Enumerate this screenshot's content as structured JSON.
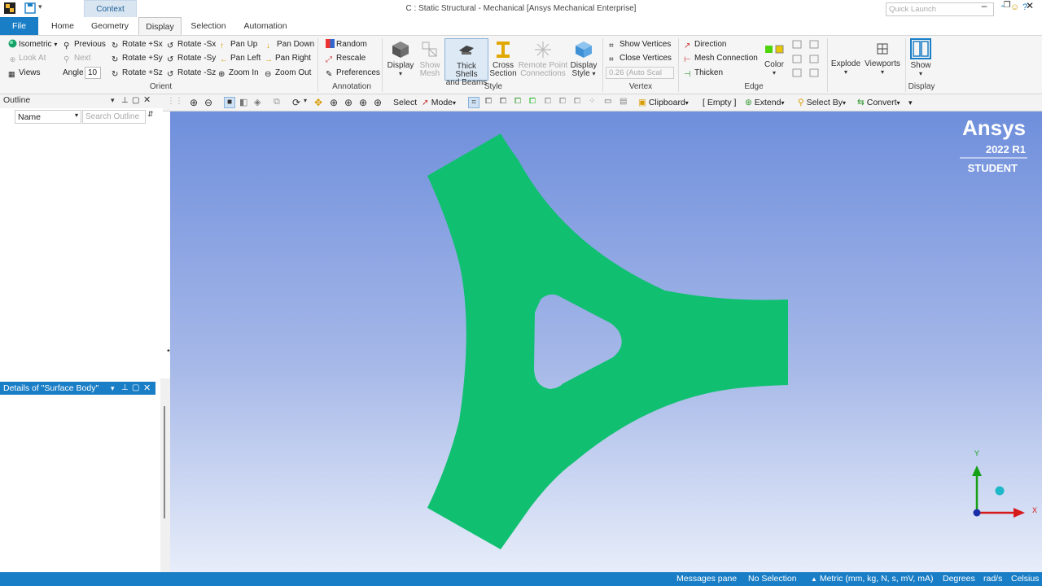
{
  "window": {
    "title": "C : Static Structural - Mechanical [Ansys Mechanical Enterprise]",
    "context_tab": "Context",
    "quick_launch_placeholder": "Quick Launch"
  },
  "tabs": [
    "File",
    "Home",
    "Geometry",
    "Display",
    "Selection",
    "Automation"
  ],
  "active_tab": "Display",
  "ribbon": {
    "orient": {
      "group_label": "Orient",
      "isometric": "Isometric",
      "look_at": "Look At",
      "views": "Views",
      "previous": "Previous",
      "next": "Next",
      "angle_label": "Angle",
      "angle_value": "10",
      "rotate_px": "Rotate +Sx",
      "rotate_py": "Rotate +Sy",
      "rotate_pz": "Rotate +Sz",
      "rotate_mx": "Rotate -Sx",
      "rotate_my": "Rotate -Sy",
      "rotate_mz": "Rotate -Sz",
      "pan_up": "Pan Up",
      "pan_left": "Pan Left",
      "zoom_in": "Zoom In",
      "pan_down": "Pan Down",
      "pan_right": "Pan Right",
      "zoom_out": "Zoom Out"
    },
    "annotation": {
      "group_label": "Annotation",
      "random": "Random",
      "rescale": "Rescale",
      "preferences": "Preferences"
    },
    "style": {
      "group_label": "Style",
      "display": "Display",
      "show_mesh_1": "Show",
      "show_mesh_2": "Mesh",
      "thick_1": "Thick Shells",
      "thick_2": "and Beams",
      "cross_1": "Cross",
      "cross_2": "Section",
      "remote_1": "Remote Point",
      "remote_2": "Connections",
      "dstyle_1": "Display",
      "dstyle_2": "Style"
    },
    "vertex": {
      "group_label": "Vertex",
      "show_vertices": "Show Vertices",
      "close_vertices": "Close Vertices",
      "auto_scale": "0.26 (Auto Scal"
    },
    "edge": {
      "group_label": "Edge",
      "direction": "Direction",
      "mesh_connection": "Mesh Connection",
      "thicken": "Thicken",
      "color": "Color"
    },
    "explode": "Explode",
    "viewports": "Viewports",
    "display_group": {
      "group_label": "Display",
      "show": "Show"
    }
  },
  "toolbar": {
    "select": "Select",
    "mode": "Mode",
    "clipboard": "Clipboard",
    "empty": "[ Empty ]",
    "extend": "Extend",
    "select_by": "Select By",
    "convert": "Convert"
  },
  "outline": {
    "title": "Outline",
    "name_column": "Name",
    "search_placeholder": "Search Outline"
  },
  "details": {
    "title": "Details of \"Surface Body\""
  },
  "viewport": {
    "brand": "Ansys",
    "version": "2022 R1",
    "edition": "STUDENT",
    "axis_y": "Y",
    "axis_x": "X",
    "body_color": "#10c070"
  },
  "status": {
    "messages": "Messages pane",
    "selection": "No Selection",
    "units": "Metric (mm, kg, N, s, mV, mA)",
    "angle": "Degrees",
    "rate": "rad/s",
    "temp": "Celsius"
  },
  "colors": {
    "accent": "#1a7ec6",
    "ribbon_bg": "#f5f5f5"
  }
}
